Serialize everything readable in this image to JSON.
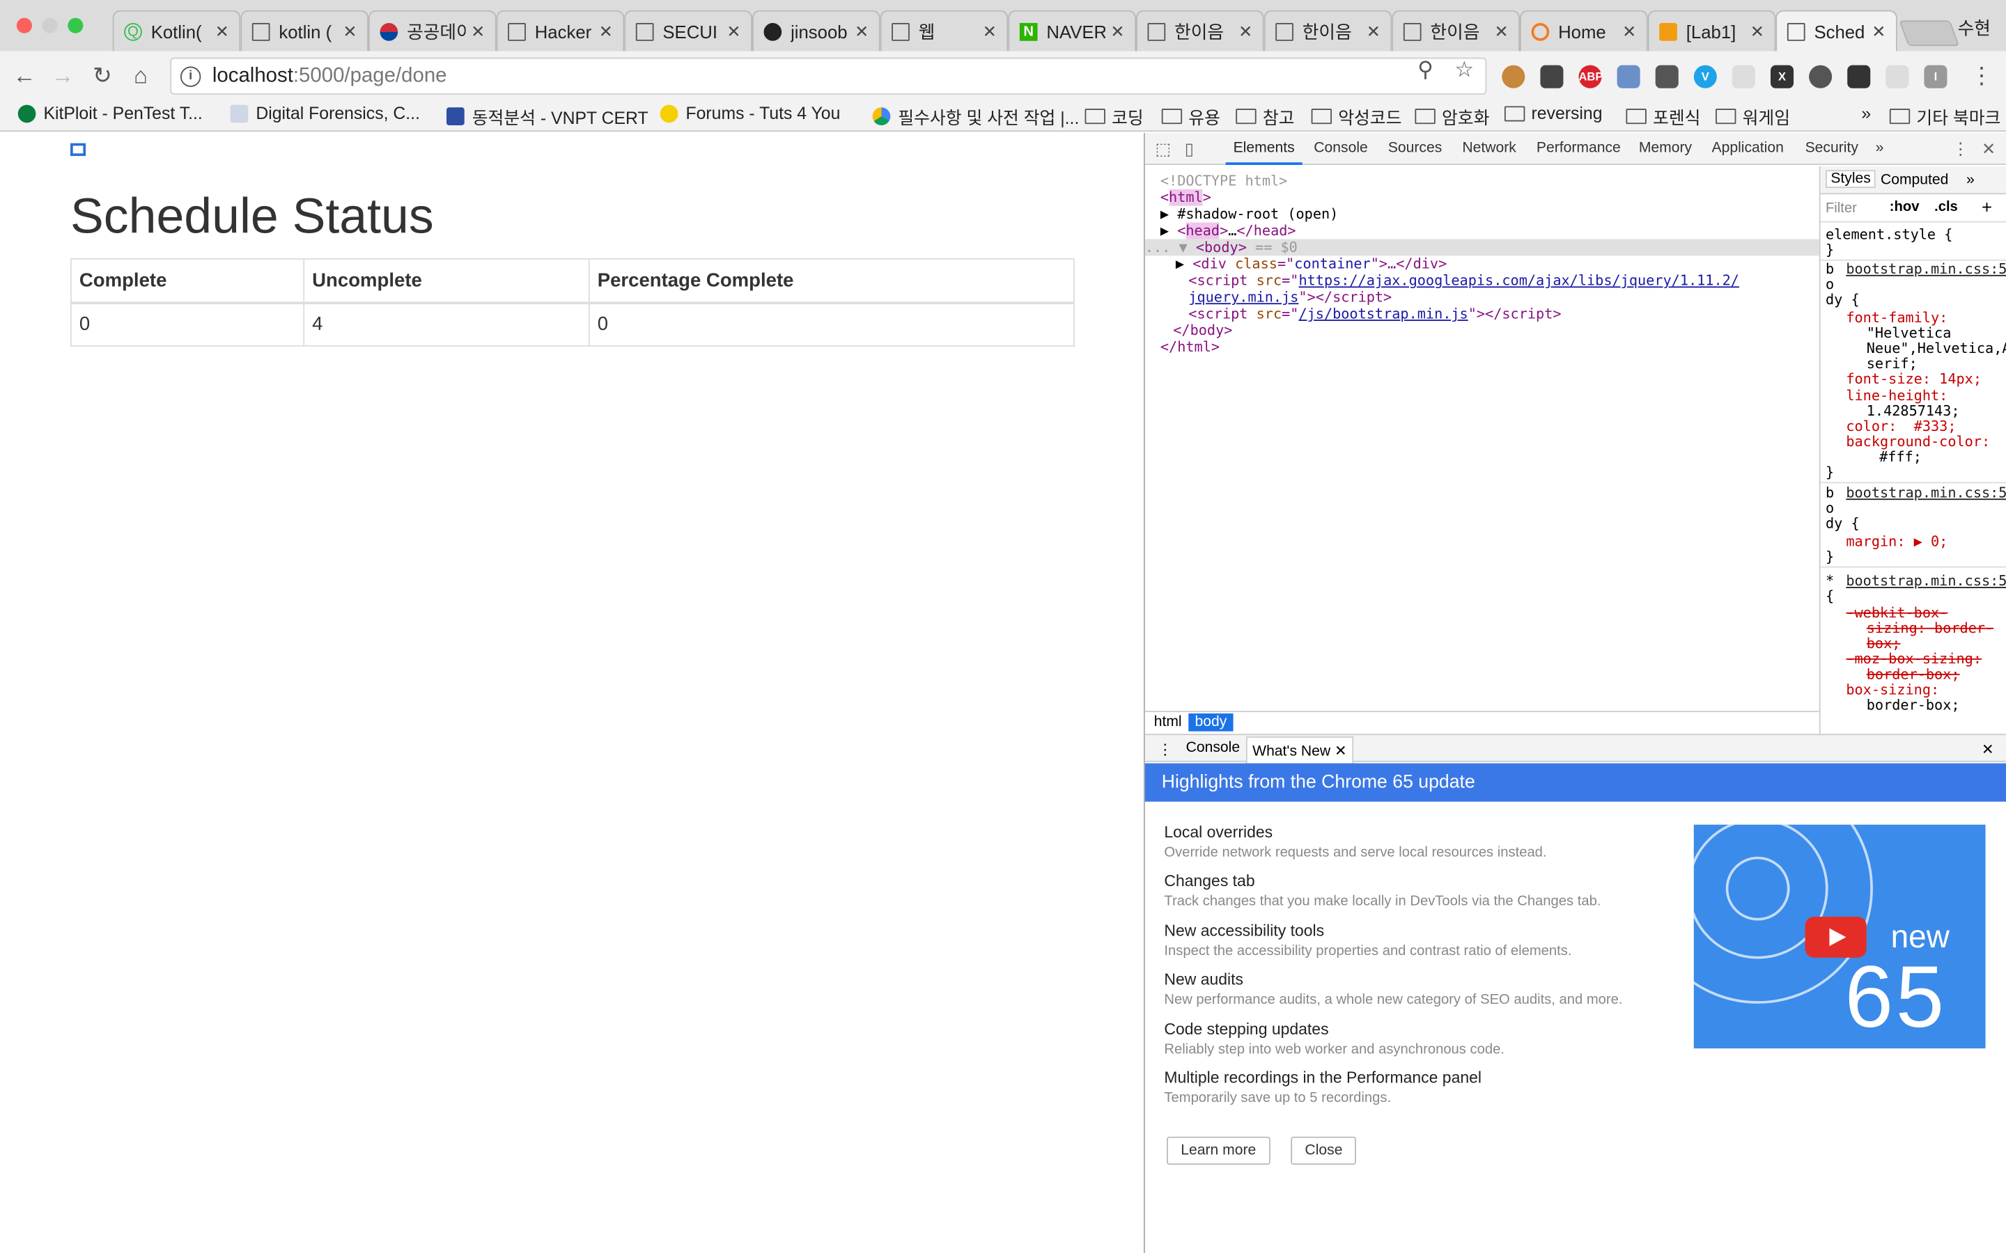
{
  "tabs": [
    {
      "label": "Kotlin(",
      "icon": "kotlin-favicon-icon"
    },
    {
      "label": "kotlin (",
      "icon": "doc-icon"
    },
    {
      "label": "공공데이",
      "icon": "korea-gov-icon"
    },
    {
      "label": "Hacker",
      "icon": "doc-icon"
    },
    {
      "label": "SECUI",
      "icon": "doc-icon"
    },
    {
      "label": "jinsoob",
      "icon": "github-icon"
    },
    {
      "label": "웹",
      "icon": "doc-icon"
    },
    {
      "label": "NAVER",
      "icon": "naver-icon"
    },
    {
      "label": "한이음",
      "icon": "doc-icon"
    },
    {
      "label": "한이음",
      "icon": "doc-icon"
    },
    {
      "label": "한이음",
      "icon": "doc-icon"
    },
    {
      "label": "Home",
      "icon": "home-ring-icon"
    },
    {
      "label": "[Lab1]",
      "icon": "lab-icon"
    },
    {
      "label": "Sched",
      "icon": "doc-icon"
    }
  ],
  "profile_name": "수현",
  "address": {
    "host": "localhost",
    "path": ":5000/page/done"
  },
  "bookmarks": [
    {
      "label": "KitPloit - PenTest T...",
      "type": "site"
    },
    {
      "label": "Digital Forensics, C...",
      "type": "site"
    },
    {
      "label": "동적분석 - VNPT CERT",
      "type": "site"
    },
    {
      "label": "Forums - Tuts 4 You",
      "type": "site"
    },
    {
      "label": "필수사항 및 사전 작업  |...",
      "type": "site"
    },
    {
      "label": "코딩",
      "type": "folder"
    },
    {
      "label": "유용",
      "type": "folder"
    },
    {
      "label": "참고",
      "type": "folder"
    },
    {
      "label": "악성코드",
      "type": "folder"
    },
    {
      "label": "암호화",
      "type": "folder"
    },
    {
      "label": "reversing",
      "type": "folder"
    },
    {
      "label": "포렌식",
      "type": "folder"
    },
    {
      "label": "워게임",
      "type": "folder"
    }
  ],
  "bookmarks_overflow": "»",
  "other_bookmarks": "기타 북마크",
  "page": {
    "heading": "Schedule Status",
    "columns": [
      "Complete",
      "Uncomplete",
      "Percentage Complete"
    ],
    "row": [
      "0",
      "4",
      "0"
    ]
  },
  "devtools": {
    "tabs": [
      "Elements",
      "Console",
      "Sources",
      "Network",
      "Performance",
      "Memory",
      "Application",
      "Security"
    ],
    "overflow": "»",
    "dom": {
      "doctype": "<!DOCTYPE html>",
      "html_open": "html",
      "shadow_root": "#shadow-root (open)",
      "head": "head",
      "head_ellipsis": "…",
      "body": "body",
      "body_marker": " == $0",
      "div_class": "container",
      "script1_src_a": "https://ajax.googleapis.com/ajax/libs/jquery/1.11.2/",
      "script1_src_b": "jquery.min.js",
      "script2_src": "/js/bootstrap.min.js"
    },
    "styles_tabs": [
      "Styles",
      "Computed"
    ],
    "styles_overflow": "»",
    "filter_placeholder": "Filter",
    "filter_hov": ":hov",
    "filter_cls": ".cls",
    "filter_add": "+",
    "styles_lines": {
      "element_style": "element.style {",
      "close": "}",
      "src": "bootstrap.min.css:5",
      "body_sel_b": "b",
      "body_sel_o": "o",
      "body_sel_dy": "dy {",
      "ff_prop": "font-family:",
      "ff_val1": "\"Helvetica",
      "ff_val2": "Neue\",Helvetica,A",
      "ff_val3": "serif;",
      "fs": "font-size: 14px;",
      "lh_prop": "line-height:",
      "lh_val": "1.42857143;",
      "color": "color:  #333;",
      "bg_prop": "background-color:",
      "bg_val": "#fff;",
      "margin": "margin: ▶ 0;",
      "star": "*",
      "star_brace": "{",
      "wk1": "-webkit-box-",
      "wk2": "sizing: border-",
      "wk3": "box;",
      "moz1": "-moz-box-sizing:",
      "moz2": "border-box;",
      "bs1": "box-sizing:",
      "bs2": "border-box;"
    },
    "breadcrumbs": [
      "html",
      "body"
    ],
    "drawer_tabs": [
      "Console",
      "What's New"
    ],
    "whats_new_title": "Highlights from the Chrome 65 update",
    "features": [
      {
        "name": "Local overrides",
        "desc": "Override network requests and serve local resources instead."
      },
      {
        "name": "Changes tab",
        "desc": "Track changes that you make locally in DevTools via the Changes tab."
      },
      {
        "name": "New accessibility tools",
        "desc": "Inspect the accessibility properties and contrast ratio of elements."
      },
      {
        "name": "New audits",
        "desc": "New performance audits, a whole new category of SEO audits, and more."
      },
      {
        "name": "Code stepping updates",
        "desc": "Reliably step into web worker and asynchronous code."
      },
      {
        "name": "Multiple recordings in the Performance panel",
        "desc": "Temporarily save up to 5 recordings."
      }
    ],
    "promo_new": "new",
    "promo_version": "65",
    "learn_more": "Learn more",
    "close": "Close"
  },
  "colors": {
    "devtools_accent": "#1a73e8",
    "whats_new_header": "#3b78e7",
    "heading_text": "#333333"
  }
}
